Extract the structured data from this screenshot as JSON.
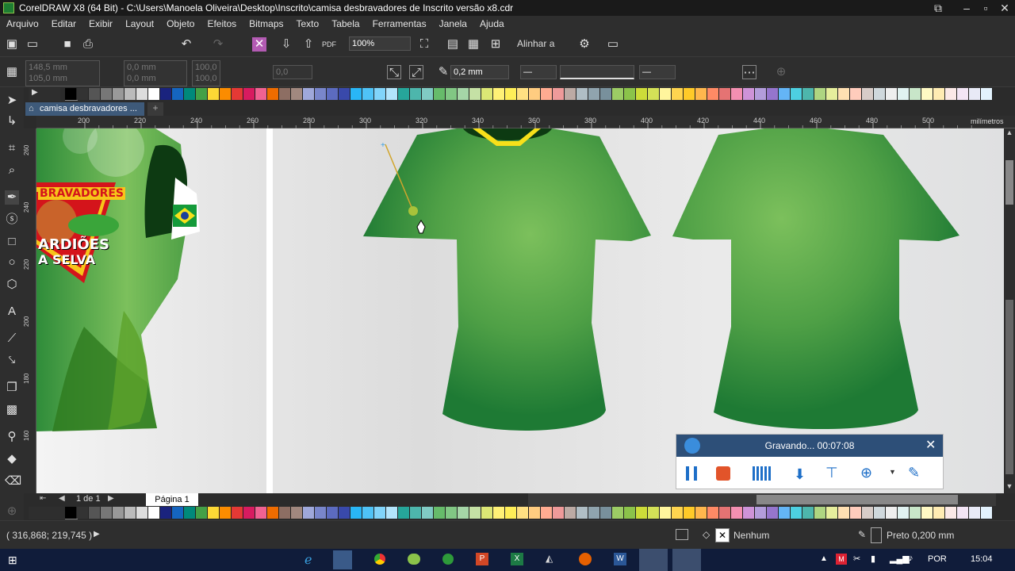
{
  "window": {
    "title": "CorelDRAW X8 (64 Bit) - C:\\Users\\Manoela Oliveira\\Desktop\\Inscrito\\camisa desbravadores de Inscrito versão x8.cdr"
  },
  "menu": [
    "Arquivo",
    "Editar",
    "Exibir",
    "Layout",
    "Objeto",
    "Efeitos",
    "Bitmaps",
    "Texto",
    "Tabela",
    "Ferramentas",
    "Janela",
    "Ajuda"
  ],
  "toolbar": {
    "zoom": "100%",
    "align_label": "Alinhar a"
  },
  "propbar": {
    "x": "148,5 mm",
    "y": "105,0 mm",
    "w": "0,0 mm",
    "h": "0,0 mm",
    "sx": "100,0",
    "sy": "100,0",
    "angle": "0,0",
    "outline": "0,2 mm"
  },
  "document_tab": "camisa desbravadores ...",
  "ruler": {
    "labels": [
      "200",
      "220",
      "240",
      "260",
      "280",
      "300",
      "320",
      "340",
      "360",
      "380",
      "400",
      "420",
      "440",
      "460",
      "480",
      "500"
    ],
    "unit": "milímetros"
  },
  "vruler": [
    "260",
    "240",
    "220",
    "200",
    "180",
    "160"
  ],
  "logo": {
    "line1": "BRAVADORES",
    "line2": "ARDIÕES",
    "line3": "A SELVA"
  },
  "pages": {
    "counter": "1 de 1",
    "page_tab": "Página 1"
  },
  "status": {
    "coords": "( 316,868; 219,745 )",
    "fill": "Nenhum",
    "outline": "Preto  0,200 mm"
  },
  "recorder": {
    "title": "Gravando... 00:07:08"
  },
  "taskbar": {
    "lang": "POR",
    "time": "15:04"
  },
  "colors": {
    "shirt_dark": "#1e7a34",
    "shirt_light": "#7cc05c",
    "accent": "#f7e01a"
  }
}
